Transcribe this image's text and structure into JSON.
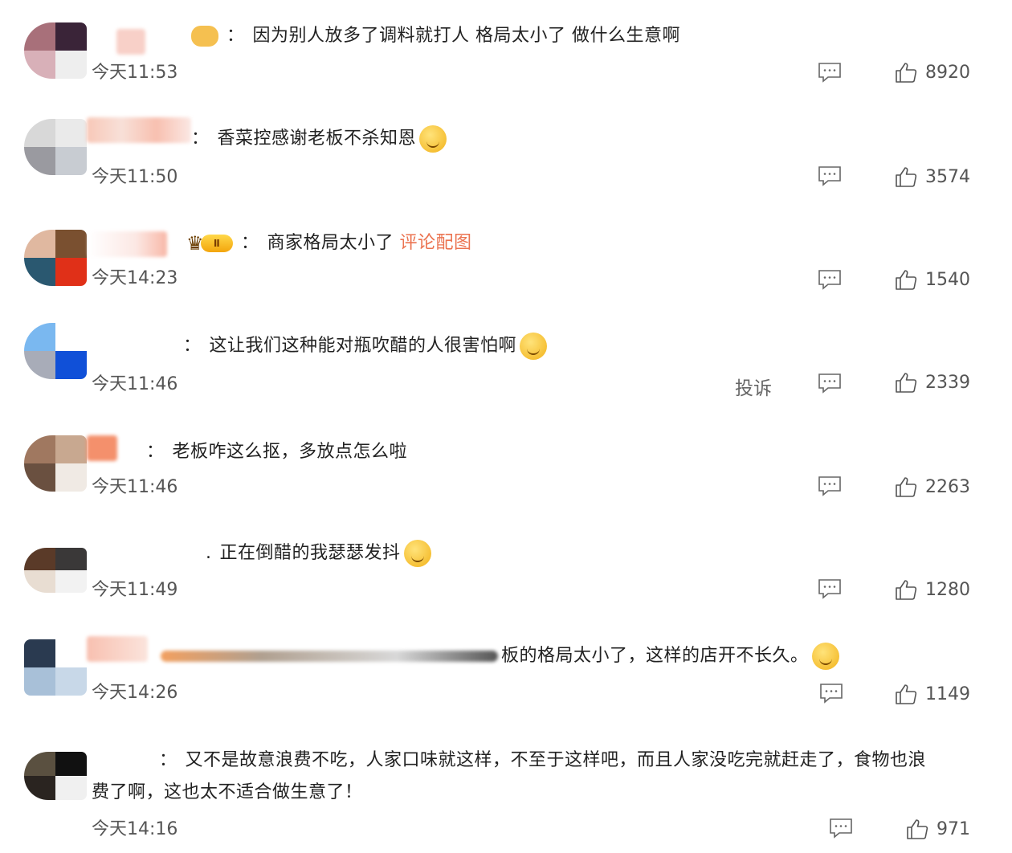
{
  "comments": [
    {
      "text": "因为别人放多了调料就打人 格局太小了 做什么生意啊",
      "time": "今天11:53",
      "likes": "8920"
    },
    {
      "text": "香菜控感谢老板不杀知恩",
      "time": "今天11:50",
      "likes": "3574"
    },
    {
      "text": "商家格局太小了",
      "link": "评论配图",
      "time": "今天14:23",
      "likes": "1540"
    },
    {
      "text": "这让我们这种能对瓶吹醋的人很害怕啊",
      "time": "今天11:46",
      "likes": "2339",
      "report": "投诉"
    },
    {
      "text": "老板咋这么抠，多放点怎么啦",
      "time": "今天11:46",
      "likes": "2263"
    },
    {
      "text": "正在倒醋的我瑟瑟发抖",
      "time": "今天11:49",
      "likes": "1280"
    },
    {
      "text": "板的格局太小了，这样的店开不长久。",
      "time": "今天14:26",
      "likes": "1149"
    },
    {
      "text": "又不是故意浪费不吃，人家口味就这样，不至于这样吧，而且人家没吃完就赶走了，食物也浪",
      "text2": "费了啊，这也太不适合做生意了！",
      "time": "今天14:16",
      "likes": "971"
    }
  ],
  "colors": {
    "link": "#eb7350",
    "icon": "#666666"
  }
}
